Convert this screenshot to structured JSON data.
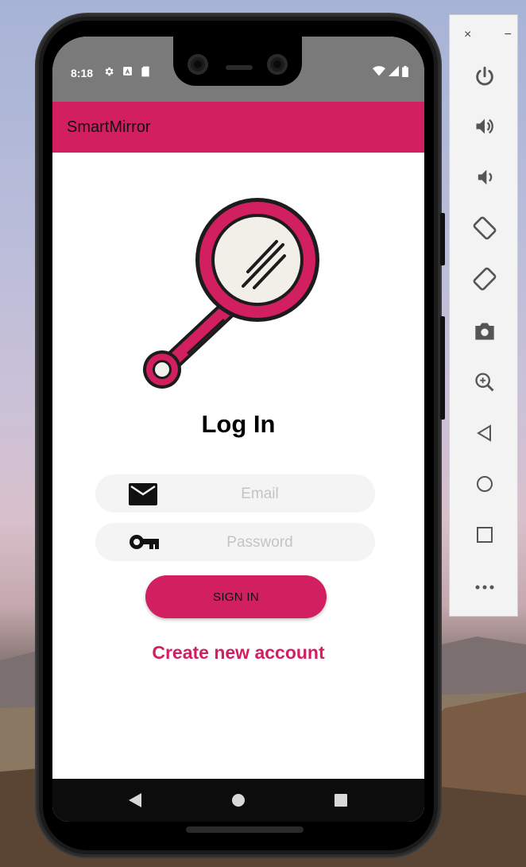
{
  "statusbar": {
    "time": "8:18",
    "left_icons": [
      "gear-icon",
      "a-badge-icon",
      "sd-card-icon"
    ],
    "right_icons": [
      "wifi-icon",
      "signal-icon",
      "battery-icon"
    ]
  },
  "appbar": {
    "title": "SmartMirror"
  },
  "logo": {
    "icon": "hand-mirror-icon",
    "accent": "#d11f60"
  },
  "login": {
    "title": "Log In",
    "email_placeholder": "Email",
    "password_placeholder": "Password",
    "email_icon": "envelope-icon",
    "password_icon": "key-icon",
    "signin_label": "SIGN IN",
    "create_account_label": "Create new account"
  },
  "navbar": {
    "buttons": [
      "back-icon",
      "home-icon",
      "recents-icon"
    ]
  },
  "emulator_toolbar": {
    "window_controls": [
      "close-icon",
      "minimize-icon"
    ],
    "close_glyph": "×",
    "minimize_glyph": "−",
    "buttons": [
      "power-icon",
      "volume-up-icon",
      "volume-down-icon",
      "rotate-left-icon",
      "rotate-right-icon",
      "camera-icon",
      "zoom-icon",
      "back-icon",
      "home-icon",
      "overview-icon",
      "more-icon"
    ]
  },
  "colors": {
    "accent": "#d11f60",
    "statusbar": "#7a7a7a",
    "navbar": "#0c0c0c"
  }
}
